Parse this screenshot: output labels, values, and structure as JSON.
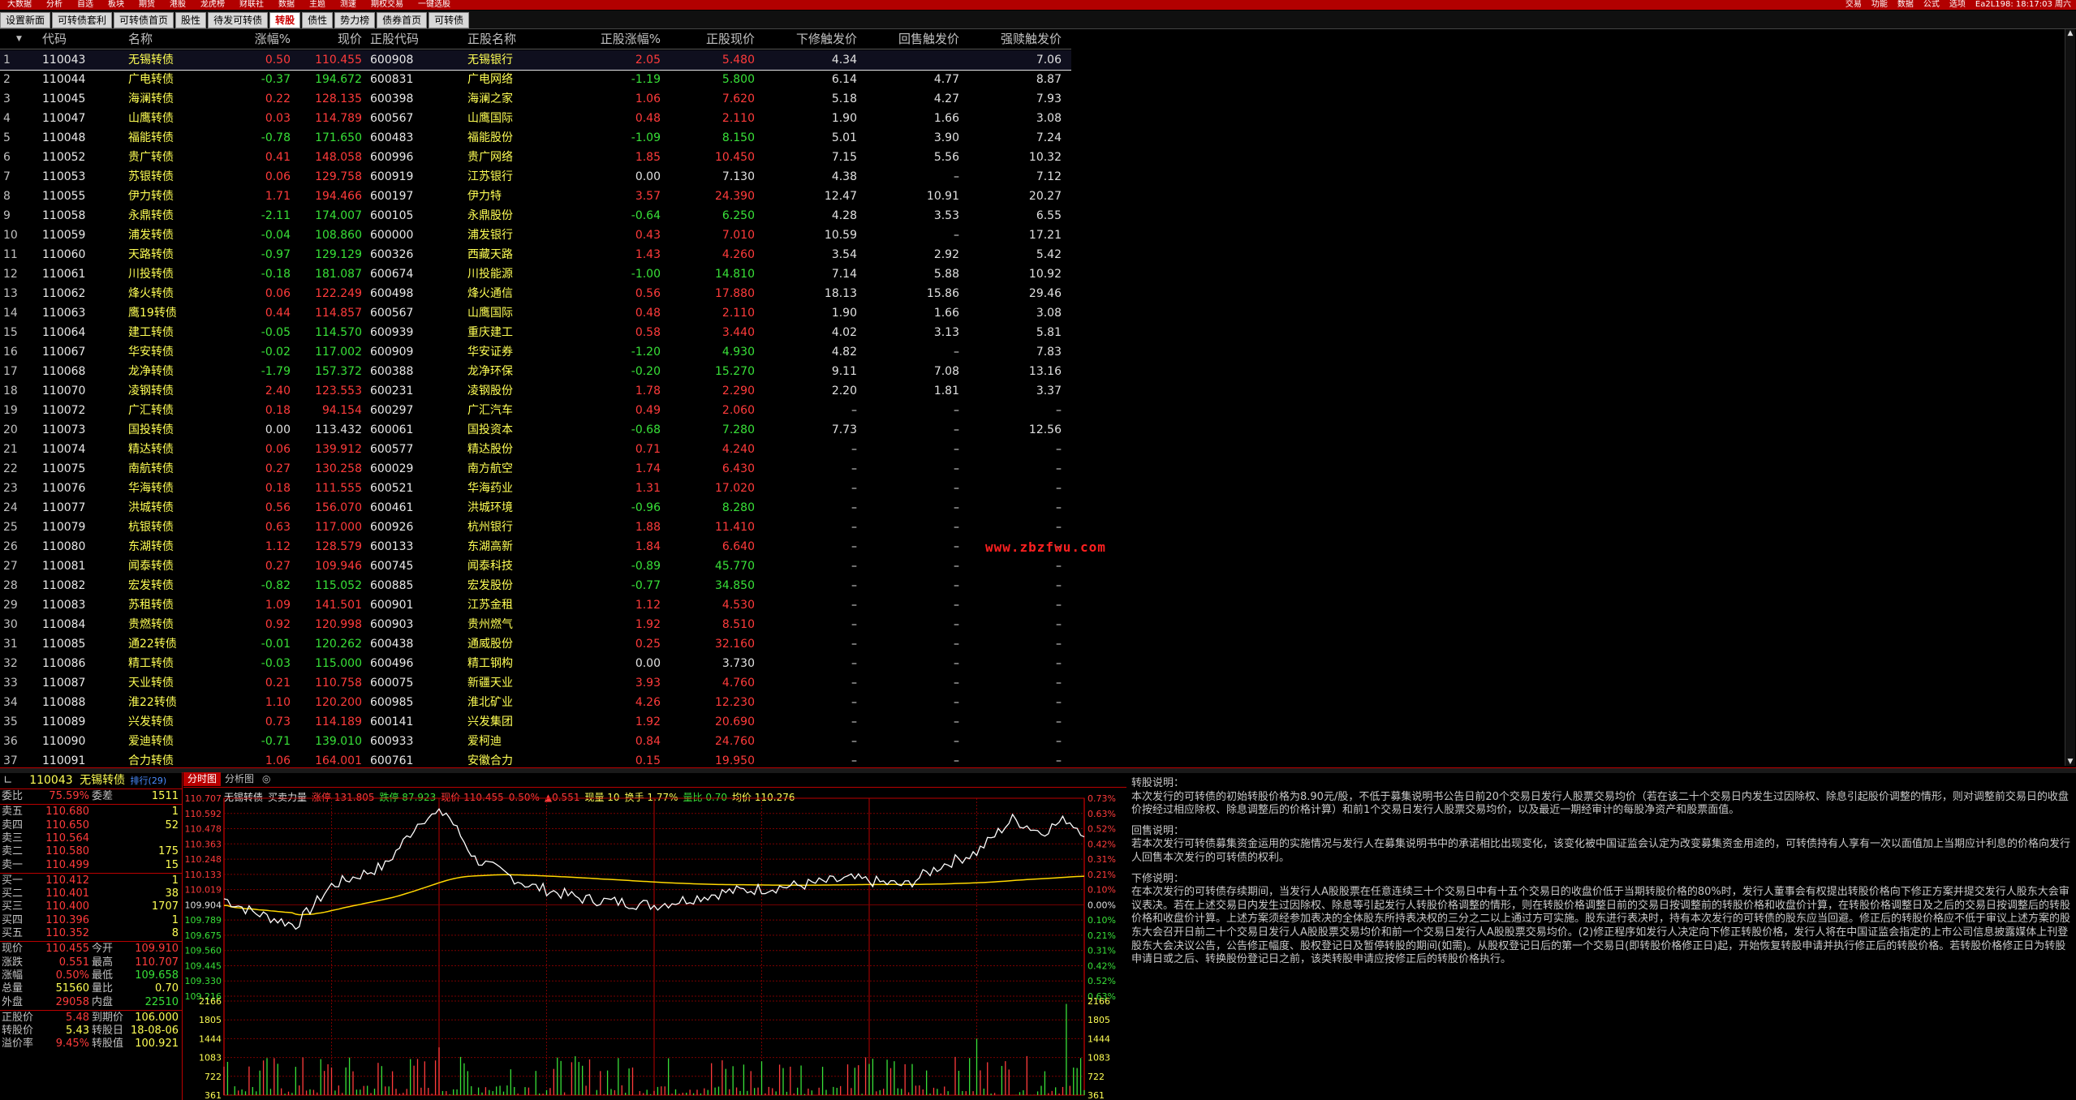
{
  "top_menu": [
    "大数据",
    "分析",
    "自选",
    "板块",
    "期货",
    "港股",
    "龙虎榜",
    "财联社",
    "数据",
    "主题",
    "测速",
    "期权交易",
    "一键选股"
  ],
  "top_right": [
    "交易",
    "功能",
    "数据",
    "公式",
    "选项",
    "Ea2L198: 18:17:03 周六"
  ],
  "tabs": [
    {
      "label": "设置新面",
      "active": false
    },
    {
      "label": "可转债套利",
      "active": false
    },
    {
      "label": "可转债首页",
      "active": false
    },
    {
      "label": "股性",
      "active": false
    },
    {
      "label": "待发可转债",
      "active": false
    },
    {
      "label": "转股",
      "active": true
    },
    {
      "label": "债性",
      "active": false
    },
    {
      "label": "势力榜",
      "active": false
    },
    {
      "label": "债券首页",
      "active": false
    },
    {
      "label": "可转债",
      "active": false
    }
  ],
  "table": {
    "sort_mark": "▼",
    "headers": [
      "代码",
      "名称",
      "涨幅%",
      "现价",
      "正股代码",
      "正股名称",
      "正股涨幅%",
      "正股现价",
      "下修触发价",
      "回售触发价",
      "强赎触发价"
    ],
    "rows": [
      [
        "1",
        "110043",
        "无锡转债",
        "0.50",
        "110.455",
        "600908",
        "无锡银行",
        "2.05",
        "5.480",
        "4.34",
        "",
        "7.06"
      ],
      [
        "2",
        "110044",
        "广电转债",
        "-0.37",
        "194.672",
        "600831",
        "广电网络",
        "-1.19",
        "5.800",
        "6.14",
        "4.77",
        "8.87"
      ],
      [
        "3",
        "110045",
        "海澜转债",
        "0.22",
        "128.135",
        "600398",
        "海澜之家",
        "1.06",
        "7.620",
        "5.18",
        "4.27",
        "7.93"
      ],
      [
        "4",
        "110047",
        "山鹰转债",
        "0.03",
        "114.789",
        "600567",
        "山鹰国际",
        "0.48",
        "2.110",
        "1.90",
        "1.66",
        "3.08"
      ],
      [
        "5",
        "110048",
        "福能转债",
        "-0.78",
        "171.650",
        "600483",
        "福能股份",
        "-1.09",
        "8.150",
        "5.01",
        "3.90",
        "7.24"
      ],
      [
        "6",
        "110052",
        "贵广转债",
        "0.41",
        "148.058",
        "600996",
        "贵广网络",
        "1.85",
        "10.450",
        "7.15",
        "5.56",
        "10.32"
      ],
      [
        "7",
        "110053",
        "苏银转债",
        "0.06",
        "129.758",
        "600919",
        "江苏银行",
        "0.00",
        "7.130",
        "4.38",
        "–",
        "7.12"
      ],
      [
        "8",
        "110055",
        "伊力转债",
        "1.71",
        "194.466",
        "600197",
        "伊力特",
        "3.57",
        "24.390",
        "12.47",
        "10.91",
        "20.27"
      ],
      [
        "9",
        "110058",
        "永鼎转债",
        "-2.11",
        "174.007",
        "600105",
        "永鼎股份",
        "-0.64",
        "6.250",
        "4.28",
        "3.53",
        "6.55"
      ],
      [
        "10",
        "110059",
        "浦发转债",
        "-0.04",
        "108.860",
        "600000",
        "浦发银行",
        "0.43",
        "7.010",
        "10.59",
        "–",
        "17.21"
      ],
      [
        "11",
        "110060",
        "天路转债",
        "-0.97",
        "129.129",
        "600326",
        "西藏天路",
        "1.43",
        "4.260",
        "3.54",
        "2.92",
        "5.42"
      ],
      [
        "12",
        "110061",
        "川投转债",
        "-0.18",
        "181.087",
        "600674",
        "川投能源",
        "-1.00",
        "14.810",
        "7.14",
        "5.88",
        "10.92"
      ],
      [
        "13",
        "110062",
        "烽火转债",
        "0.06",
        "122.249",
        "600498",
        "烽火通信",
        "0.56",
        "17.880",
        "18.13",
        "15.86",
        "29.46"
      ],
      [
        "14",
        "110063",
        "鹰19转债",
        "0.44",
        "114.857",
        "600567",
        "山鹰国际",
        "0.48",
        "2.110",
        "1.90",
        "1.66",
        "3.08"
      ],
      [
        "15",
        "110064",
        "建工转债",
        "-0.05",
        "114.570",
        "600939",
        "重庆建工",
        "0.58",
        "3.440",
        "4.02",
        "3.13",
        "5.81"
      ],
      [
        "16",
        "110067",
        "华安转债",
        "-0.02",
        "117.002",
        "600909",
        "华安证券",
        "-1.20",
        "4.930",
        "4.82",
        "–",
        "7.83"
      ],
      [
        "17",
        "110068",
        "龙净转债",
        "-1.79",
        "157.372",
        "600388",
        "龙净环保",
        "-0.20",
        "15.270",
        "9.11",
        "7.08",
        "13.16"
      ],
      [
        "18",
        "110070",
        "凌钢转债",
        "2.40",
        "123.553",
        "600231",
        "凌钢股份",
        "1.78",
        "2.290",
        "2.20",
        "1.81",
        "3.37"
      ],
      [
        "19",
        "110072",
        "广汇转债",
        "0.18",
        "94.154",
        "600297",
        "广汇汽车",
        "0.49",
        "2.060",
        "–",
        "–",
        "–"
      ],
      [
        "20",
        "110073",
        "国投转债",
        "0.00",
        "113.432",
        "600061",
        "国投资本",
        "-0.68",
        "7.280",
        "7.73",
        "–",
        "12.56"
      ],
      [
        "21",
        "110074",
        "精达转债",
        "0.06",
        "139.912",
        "600577",
        "精达股份",
        "0.71",
        "4.240",
        "–",
        "–",
        "–"
      ],
      [
        "22",
        "110075",
        "南航转债",
        "0.27",
        "130.258",
        "600029",
        "南方航空",
        "1.74",
        "6.430",
        "–",
        "–",
        "–"
      ],
      [
        "23",
        "110076",
        "华海转债",
        "0.18",
        "111.555",
        "600521",
        "华海药业",
        "1.31",
        "17.020",
        "–",
        "–",
        "–"
      ],
      [
        "24",
        "110077",
        "洪城转债",
        "0.56",
        "156.070",
        "600461",
        "洪城环境",
        "-0.96",
        "8.280",
        "–",
        "–",
        "–"
      ],
      [
        "25",
        "110079",
        "杭银转债",
        "0.63",
        "117.000",
        "600926",
        "杭州银行",
        "1.88",
        "11.410",
        "–",
        "–",
        "–"
      ],
      [
        "26",
        "110080",
        "东湖转债",
        "1.12",
        "128.579",
        "600133",
        "东湖高新",
        "1.84",
        "6.640",
        "–",
        "–",
        "–"
      ],
      [
        "27",
        "110081",
        "闻泰转债",
        "0.27",
        "109.946",
        "600745",
        "闻泰科技",
        "-0.89",
        "45.770",
        "–",
        "–",
        "–"
      ],
      [
        "28",
        "110082",
        "宏发转债",
        "-0.82",
        "115.052",
        "600885",
        "宏发股份",
        "-0.77",
        "34.850",
        "–",
        "–",
        "–"
      ],
      [
        "29",
        "110083",
        "苏租转债",
        "1.09",
        "141.501",
        "600901",
        "江苏金租",
        "1.12",
        "4.530",
        "–",
        "–",
        "–"
      ],
      [
        "30",
        "110084",
        "贵燃转债",
        "0.92",
        "120.998",
        "600903",
        "贵州燃气",
        "1.92",
        "8.510",
        "–",
        "–",
        "–"
      ],
      [
        "31",
        "110085",
        "通22转债",
        "-0.01",
        "120.262",
        "600438",
        "通威股份",
        "0.25",
        "32.160",
        "–",
        "–",
        "–"
      ],
      [
        "32",
        "110086",
        "精工转债",
        "-0.03",
        "115.000",
        "600496",
        "精工钢构",
        "0.00",
        "3.730",
        "–",
        "–",
        "–"
      ],
      [
        "33",
        "110087",
        "天业转债",
        "0.21",
        "110.758",
        "600075",
        "新疆天业",
        "3.93",
        "4.760",
        "–",
        "–",
        "–"
      ],
      [
        "34",
        "110088",
        "淮22转债",
        "1.10",
        "120.200",
        "600985",
        "淮北矿业",
        "4.26",
        "12.230",
        "–",
        "–",
        "–"
      ],
      [
        "35",
        "110089",
        "兴发转债",
        "0.73",
        "114.189",
        "600141",
        "兴发集团",
        "1.92",
        "20.690",
        "–",
        "–",
        "–"
      ],
      [
        "36",
        "110090",
        "爱迪转债",
        "-0.71",
        "139.010",
        "600933",
        "爱柯迪",
        "0.84",
        "24.760",
        "–",
        "–",
        "–"
      ],
      [
        "37",
        "110091",
        "合力转债",
        "1.06",
        "164.001",
        "600761",
        "安徽合力",
        "0.15",
        "19.950",
        "–",
        "–",
        "–"
      ]
    ]
  },
  "watermark": "www.zbzfwu.com",
  "quote": {
    "code": "110043",
    "name": "无锡转债",
    "rank_badge": "排行(29)",
    "weibi_label": "委比",
    "weibi": "75.59%",
    "weicha_label": "委差",
    "weicha": "1511",
    "asks": [
      [
        "卖五",
        "110.680",
        "1"
      ],
      [
        "卖四",
        "110.650",
        "52"
      ],
      [
        "卖三",
        "110.564",
        ""
      ],
      [
        "卖二",
        "110.580",
        "175"
      ],
      [
        "卖一",
        "110.499",
        "15"
      ]
    ],
    "bids": [
      [
        "买一",
        "110.412",
        "1"
      ],
      [
        "买二",
        "110.401",
        "38"
      ],
      [
        "买三",
        "110.400",
        "1707"
      ],
      [
        "买四",
        "110.396",
        "1"
      ],
      [
        "买五",
        "110.352",
        "8"
      ]
    ],
    "stats": [
      [
        "现价",
        "110.455",
        "今开",
        "109.910"
      ],
      [
        "涨跌",
        "0.551",
        "最高",
        "110.707"
      ],
      [
        "涨幅",
        "0.50%",
        "最低",
        "109.658"
      ],
      [
        "总量",
        "51560",
        "量比",
        "0.70"
      ],
      [
        "外盘",
        "29058",
        "内盘",
        "22510"
      ],
      [
        "正股价",
        "5.48",
        "到期价",
        "106.000"
      ],
      [
        "转股价",
        "5.43",
        "转股日",
        "18-08-06"
      ],
      [
        "溢价率",
        "9.45%",
        "转股值",
        "100.921"
      ]
    ]
  },
  "chart": {
    "tabs": [
      "分时图",
      "分析图",
      "◎"
    ],
    "info": [
      "无锡转债",
      "买卖力量",
      "涨停 131.805",
      "跌停 87.923",
      "现价 110.455",
      "0.50%",
      "▲0.551",
      "现量 10",
      "换手 1.77%",
      "量比 0.70",
      "均价 110.276"
    ],
    "price_axis": [
      "110.707",
      "110.592",
      "110.478",
      "110.363",
      "110.248",
      "110.133",
      "110.019",
      "109.904",
      "109.789",
      "109.675",
      "109.560",
      "109.445",
      "109.330",
      "109.216"
    ],
    "pct_axis": [
      "0.73%",
      "0.63%",
      "0.52%",
      "0.42%",
      "0.31%",
      "0.21%",
      "0.10%",
      "0.00%",
      "0.10%",
      "0.21%",
      "0.31%",
      "0.42%",
      "0.52%",
      "0.63%"
    ],
    "vol_axis": [
      "2166",
      "1805",
      "1444",
      "1083",
      "722",
      "361"
    ],
    "colors": {
      "price_line": "#ffffff",
      "avg_line": "#ffd700",
      "grid": "#7a0000",
      "up": "#ff3b3b",
      "down": "#38e038"
    }
  },
  "description": [
    "转股说明：",
    "本次发行的可转债的初始转股价格为8.90元/股，不低于募集说明书公告日前20个交易日发行人股票交易均价（若在该二十个交易日内发生过因除权、除息引起股价调整的情形，则对调整前交易日的收盘价按经过相应除权、除息调整后的价格计算）和前1个交易日发行人股票交易均价，以及最近一期经审计的每股净资产和股票面值。",
    "回售说明：",
    "若本次发行可转债募集资金运用的实施情况与发行人在募集说明书中的承诺相比出现变化，该变化被中国证监会认定为改变募集资金用途的，可转债持有人享有一次以面值加上当期应计利息的价格向发行人回售本次发行的可转债的权利。",
    "下修说明：",
    "在本次发行的可转债存续期间，当发行人A股股票在任意连续三十个交易日中有十五个交易日的收盘价低于当期转股价格的80%时，发行人董事会有权提出转股价格向下修正方案并提交发行人股东大会审议表决。若在上述交易日内发生过因除权、除息等引起发行人转股价格调整的情形，则在转股价格调整日前的交易日按调整前的转股价格和收盘价计算，在转股价格调整日及之后的交易日按调整后的转股价格和收盘价计算。上述方案须经参加表决的全体股东所持表决权的三分之二以上通过方可实施。股东进行表决时，持有本次发行的可转债的股东应当回避。修正后的转股价格应不低于审议上述方案的股东大会召开日前二十个交易日发行人A股股票交易均价和前一个交易日发行人A股股票交易均价。(2)修正程序如发行人决定向下修正转股价格，发行人将在中国证监会指定的上市公司信息披露媒体上刊登股东大会决议公告，公告修正幅度、股权登记日及暂停转股的期间(如需)。从股权登记日后的第一个交易日(即转股价格修正日)起，开始恢复转股申请并执行修正后的转股价格。若转股价格修正日为转股申请日或之后、转换股份登记日之前，该类转股申请应按修正后的转股价格执行。"
  ]
}
